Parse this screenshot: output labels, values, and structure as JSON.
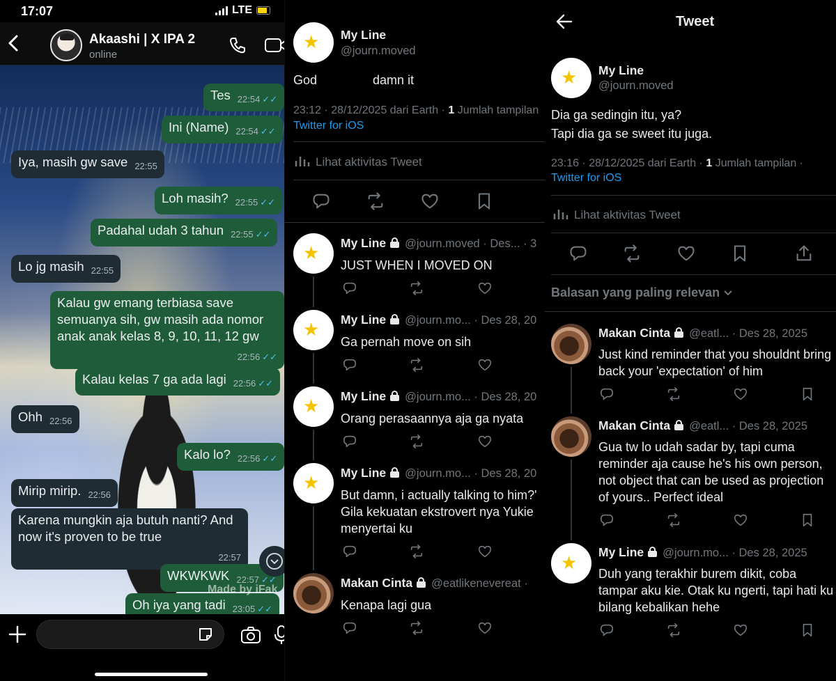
{
  "whatsapp": {
    "status": {
      "time": "17:07",
      "network": "LTE"
    },
    "contact": {
      "name": "Akaashi | X IPA 2",
      "status": "online"
    },
    "messages": [
      {
        "dir": "out",
        "text": "Tes",
        "time": "22:54"
      },
      {
        "dir": "out",
        "text": "Ini (Name)",
        "time": "22:54"
      },
      {
        "dir": "in",
        "text": "Iya, masih gw save",
        "time": "22:55"
      },
      {
        "dir": "out",
        "text": "Loh masih?",
        "time": "22:55"
      },
      {
        "dir": "out",
        "text": "Padahal udah 3 tahun",
        "time": "22:55"
      },
      {
        "dir": "in",
        "text": "Lo jg masih",
        "time": "22:55"
      },
      {
        "dir": "out",
        "text": "Kalau gw emang terbiasa save semuanya sih, gw masih ada nomor anak anak kelas 8, 9, 10, 11, 12 gw",
        "time": "22:56"
      },
      {
        "dir": "out",
        "text": "Kalau kelas 7 ga ada lagi",
        "time": "22:56"
      },
      {
        "dir": "in",
        "text": "Ohh",
        "time": "22:56"
      },
      {
        "dir": "out",
        "text": "Kalo lo?",
        "time": "22:56"
      },
      {
        "dir": "in",
        "text": "Mirip mirip.",
        "time": "22:56"
      },
      {
        "dir": "in",
        "text": "Karena mungkin aja butuh nanti? And now it's proven to be true",
        "time": "22:57"
      },
      {
        "dir": "out",
        "text": "WKWKWK",
        "time": "22:57"
      },
      {
        "dir": "out",
        "text": "Oh iya yang tadi",
        "time": "23:05"
      }
    ],
    "watermark": "Made by iFak",
    "icons": [
      "back-icon",
      "phone-icon",
      "video-icon",
      "plus-icon",
      "sticker-icon",
      "camera-icon",
      "mic-icon",
      "chevron-down-icon"
    ]
  },
  "thread": {
    "main_tweet": {
      "name": "My Line",
      "handle": "@journ.moved",
      "text": "God                damn it",
      "time": "23:12 · 28/12/2025 dari Earth · ",
      "views_count": "1",
      "views_label": " Jumlah tampilan",
      "source": "Twitter for iOS",
      "activity": "Lihat aktivitas Tweet"
    },
    "replies": [
      {
        "name": "My Line",
        "meta": "@journ.moved · Des... · 3",
        "lines": [
          "JUST WHEN I MOVED ON"
        ]
      },
      {
        "name": "My Line",
        "meta": "@journ.mo... · Des 28, 20",
        "lines": [
          "Ga pernah move on sih"
        ]
      },
      {
        "name": "My Line",
        "meta": "@journ.mo... · Des 28, 20",
        "lines": [
          "Orang perasaannya aja ga nyata"
        ]
      },
      {
        "name": "My Line",
        "meta": "@journ.mo... · Des 28, 20",
        "lines": [
          "But damn, i actually talking to him?'",
          "Gila kekuatan ekstrovert nya Yukie",
          "menyertai ku"
        ]
      },
      {
        "name": "Makan Cinta",
        "meta": "@eatlikenevereat · ",
        "lines": [
          "Kenapa lagi gua"
        ]
      }
    ]
  },
  "tweet_detail": {
    "header_title": "Tweet",
    "main_tweet": {
      "name": "My Line",
      "handle": "@journ.moved",
      "lines": [
        "Dia ga sedingin itu, ya?",
        "Tapi dia ga se sweet itu juga."
      ],
      "time": "23:16 · 28/12/2025 dari Earth · ",
      "views_count": "1",
      "views_label": " Jumlah tampilan ·",
      "source": "Twitter for iOS",
      "activity": "Lihat aktivitas Tweet"
    },
    "sort_label": "Balasan yang paling relevan",
    "replies": [
      {
        "name": "Makan Cinta",
        "meta": "@eatl... · Des 28, 2025",
        "lines": [
          "Just kind reminder that you shouldnt bring",
          "back your 'expectation' of him"
        ]
      },
      {
        "name": "Makan Cinta",
        "meta": "@eatl... · Des 28, 2025",
        "lines": [
          "Gua tw lo udah sadar by, tapi cuma",
          "reminder aja cause he's his own person,",
          "not object that can be used as projection",
          "of yours.. Perfect ideal"
        ]
      },
      {
        "name": "My Line",
        "meta": "@journ.mo... · Des 28, 2025",
        "lines": [
          "Duh yang terakhir burem dikit, coba",
          "tampar aku kie. Otak ku ngerti, tapi hati ku",
          "bilang kebalikan hehe"
        ]
      }
    ]
  },
  "colors": {
    "wa_out": "#1f5c3a",
    "wa_in": "#202c33",
    "tick": "#53bdeb",
    "link": "#1d9bf0",
    "muted": "#71767b"
  }
}
